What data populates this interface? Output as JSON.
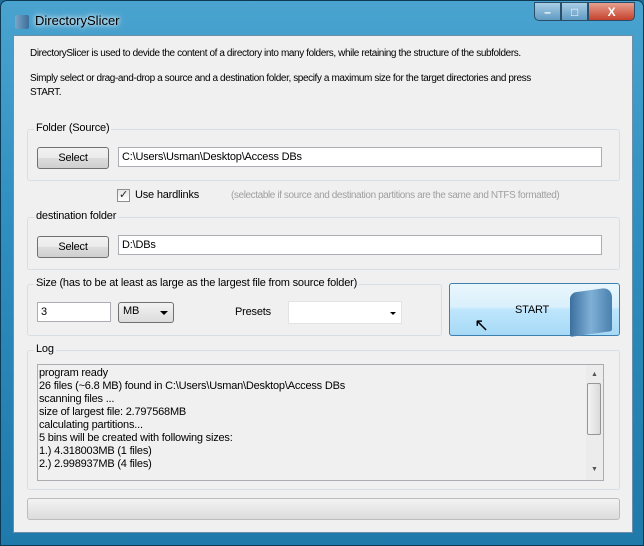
{
  "window": {
    "title": "DirectorySlicer"
  },
  "description": {
    "line1": "DirectorySlicer is used to devide the content of a directory into many folders, while retaining the structure of the subfolders.",
    "line2": "Simply select or drag-and-drop a source and a destination folder, specify a maximum size for the target directories and press",
    "line3": "START."
  },
  "source": {
    "label": "Folder (Source)",
    "button": "Select",
    "path": "C:\\Users\\Usman\\Desktop\\Access DBs"
  },
  "hardlinks": {
    "label": "Use hardlinks",
    "checked": true,
    "note": "(selectable if source and destination partitions are the same and NTFS formatted)"
  },
  "destination": {
    "label": "destination folder",
    "button": "Select",
    "path": "D:\\DBs"
  },
  "size": {
    "label": "Size (has to be at least as large as the largest file from source folder)",
    "value": "3",
    "unit": "MB",
    "presets_label": "Presets",
    "preset_value": ""
  },
  "start_label": "START",
  "log": {
    "label": "Log",
    "lines": [
      "program ready",
      "26 files (~6.8 MB) found in C:\\Users\\Usman\\Desktop\\Access DBs",
      "scanning files ...",
      "size of largest file: 2.797568MB",
      "calculating partitions...",
      "5 bins will be created with following sizes:",
      "1.) 4.318003MB (1 files)",
      "2.) 2.998937MB (4 files)"
    ]
  },
  "progress": 0
}
